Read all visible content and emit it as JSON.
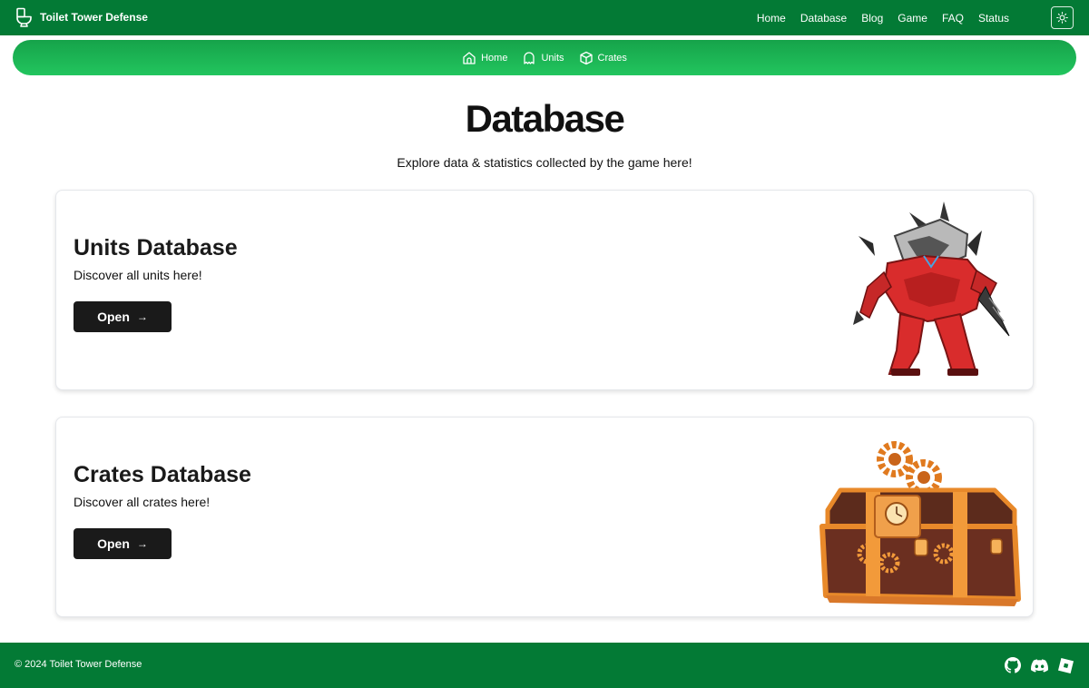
{
  "brand": {
    "name": "Toilet Tower Defense",
    "icon": "toilet-icon"
  },
  "top_nav": {
    "links": [
      "Home",
      "Database",
      "Blog",
      "Game",
      "FAQ",
      "Status"
    ],
    "theme_toggle_icon": "sun-icon"
  },
  "sub_nav": {
    "items": [
      {
        "label": "Home",
        "icon": "home-icon"
      },
      {
        "label": "Units",
        "icon": "ghost-icon"
      },
      {
        "label": "Crates",
        "icon": "box-icon"
      }
    ]
  },
  "header": {
    "title": "Database",
    "subtitle": "Explore data & statistics collected by the game here!"
  },
  "cards": [
    {
      "title": "Units Database",
      "description": "Discover all units here!",
      "button_label": "Open",
      "button_icon": "arrow-right-icon",
      "image": "red-drill-robot-unit"
    },
    {
      "title": "Crates Database",
      "description": "Discover all crates here!",
      "button_label": "Open",
      "button_icon": "arrow-right-icon",
      "image": "steampunk-treasure-crate"
    }
  ],
  "footer": {
    "copyright": "© 2024 Toilet Tower Defense",
    "social_icons": [
      "github-icon",
      "discord-icon",
      "roblox-icon"
    ]
  },
  "colors": {
    "nav_green": "#037a35",
    "subnav_gradient_start": "#16a34a",
    "subnav_gradient_end": "#22c55e",
    "button_dark": "#1a1a1a"
  }
}
